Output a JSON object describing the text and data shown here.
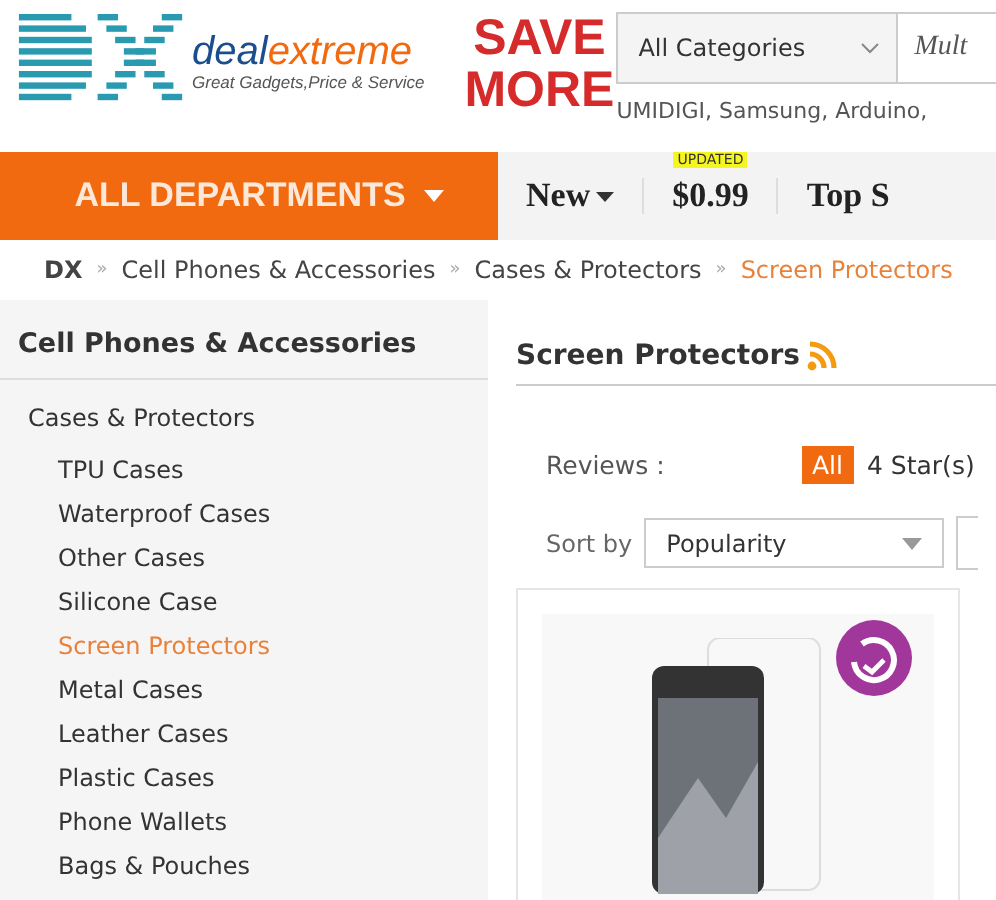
{
  "header": {
    "logo_brand": "deal",
    "logo_brand_accent": "extreme",
    "logo_tagline": "Great Gadgets,Price & Service",
    "promo": [
      "SAVE",
      "MORE"
    ],
    "category_select": "All Categories",
    "search": {
      "placeholder": "Mult"
    },
    "suggestions": "UMIDIGI, Samsung, Arduino,"
  },
  "nav": {
    "departments": "ALL DEPARTMENTS",
    "items": [
      {
        "label": "New",
        "kind": "dropdown"
      },
      {
        "label": "$0.99",
        "kind": "badge",
        "badge": "UPDATED"
      },
      {
        "label": "Top S",
        "kind": "plain"
      }
    ]
  },
  "breadcrumb": [
    {
      "label": "DX",
      "selected": false
    },
    {
      "label": "Cell Phones & Accessories",
      "selected": false
    },
    {
      "label": "Cases & Protectors",
      "selected": false
    },
    {
      "label": "Screen Protectors",
      "selected": true
    }
  ],
  "breadcrumb_separator": "»",
  "sidebar": {
    "title": "Cell Phones & Accessories",
    "items": [
      {
        "label": "Cases & Protectors",
        "children": [
          {
            "label": "TPU Cases",
            "selected": false
          },
          {
            "label": "Waterproof Cases",
            "selected": false
          },
          {
            "label": "Other Cases",
            "selected": false
          },
          {
            "label": "Silicone Case",
            "selected": false
          },
          {
            "label": "Screen Protectors",
            "selected": true
          },
          {
            "label": "Metal Cases",
            "selected": false
          },
          {
            "label": "Leather Cases",
            "selected": false
          },
          {
            "label": "Plastic Cases",
            "selected": false
          },
          {
            "label": "Phone Wallets",
            "selected": false
          },
          {
            "label": "Bags & Pouches",
            "selected": false
          }
        ]
      }
    ]
  },
  "main": {
    "title": "Screen Protectors",
    "reviews_label": "Reviews :",
    "review_filters": [
      {
        "label": "All",
        "selected": true
      },
      {
        "label": "4 Star(s)",
        "selected": false
      }
    ],
    "sort_label": "Sort by",
    "sort_value": "Popularity"
  }
}
